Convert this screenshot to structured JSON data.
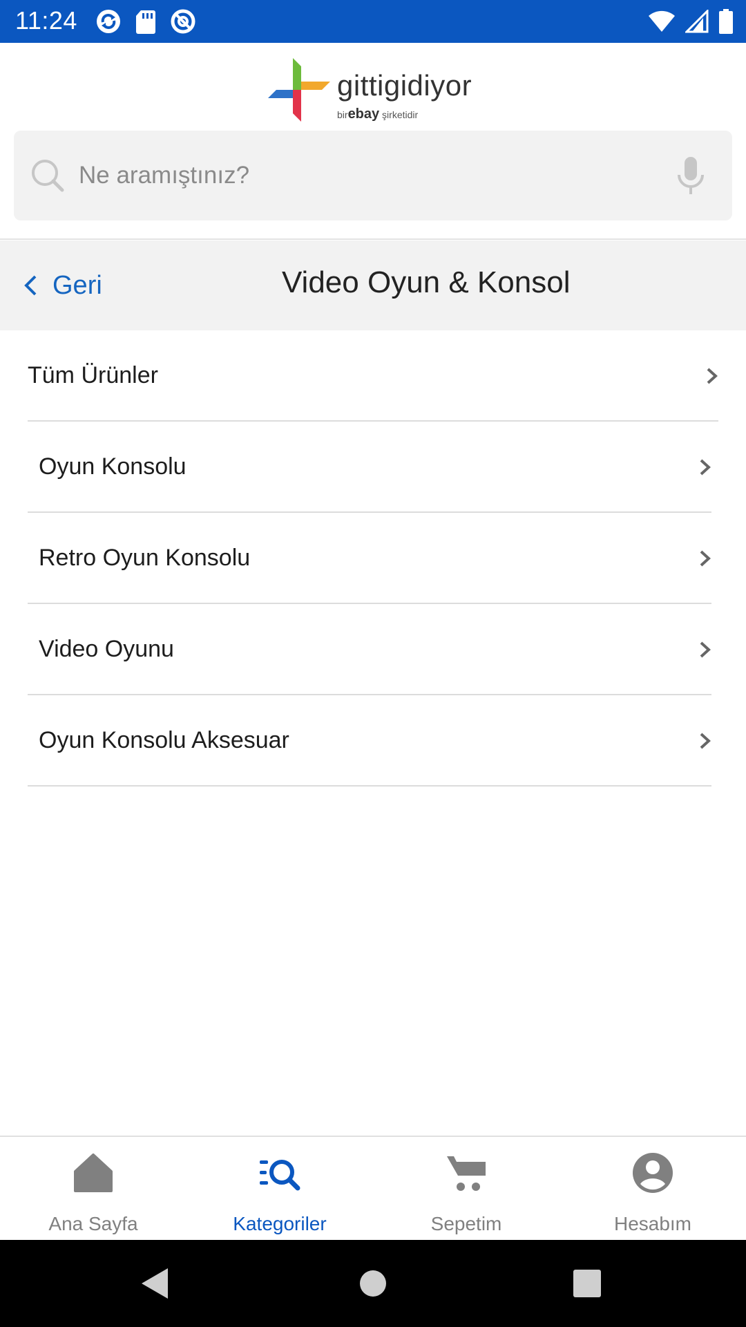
{
  "status_bar": {
    "time": "11:24",
    "left_icons": [
      "sync-icon",
      "sd-card-icon",
      "do-not-disturb-icon"
    ],
    "right_icons": [
      "wifi-icon",
      "cell-signal-icon",
      "battery-icon"
    ]
  },
  "header": {
    "logo": {
      "wordmark": "gittigidiyor",
      "tagline_prefix": "bir",
      "tagline_brand": "ebay",
      "tagline_suffix": "şirketidir"
    },
    "search": {
      "placeholder": "Ne aramıştınız?",
      "value": ""
    }
  },
  "subheader": {
    "back_label": "Geri",
    "title": "Video Oyun & Konsol"
  },
  "categories": [
    {
      "label": "Tüm Ürünler"
    },
    {
      "label": "Oyun Konsolu"
    },
    {
      "label": "Retro Oyun Konsolu"
    },
    {
      "label": "Video Oyunu"
    },
    {
      "label": "Oyun Konsolu Aksesuar"
    }
  ],
  "bottom_nav": [
    {
      "label": "Ana Sayfa",
      "icon": "home-icon",
      "active": false
    },
    {
      "label": "Kategoriler",
      "icon": "categories-search-icon",
      "active": true
    },
    {
      "label": "Sepetim",
      "icon": "cart-icon",
      "active": false
    },
    {
      "label": "Hesabım",
      "icon": "account-icon",
      "active": false
    }
  ],
  "colors": {
    "brand_blue": "#0b57c0",
    "link_blue": "#1565c0",
    "inactive_gray": "#808080",
    "subheader_bg": "#f2f2f2"
  }
}
